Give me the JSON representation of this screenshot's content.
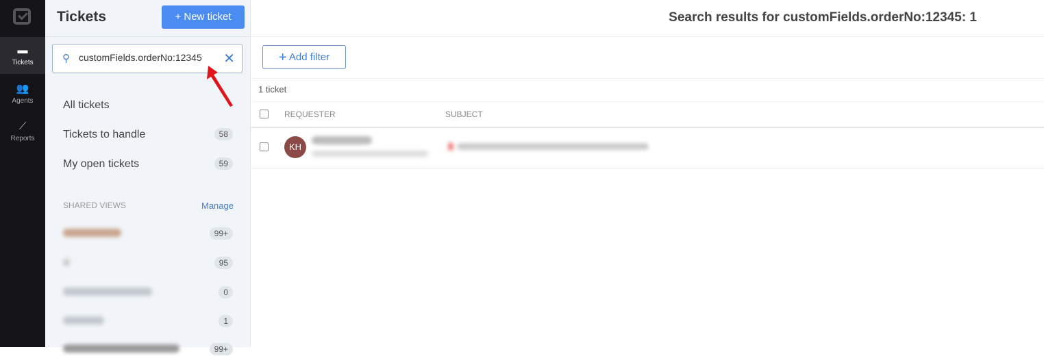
{
  "rail": {
    "items": [
      {
        "label": "Tickets",
        "icon": "ticket-icon"
      },
      {
        "label": "Agents",
        "icon": "agents-icon"
      },
      {
        "label": "Reports",
        "icon": "reports-icon"
      }
    ]
  },
  "sidebar": {
    "title": "Tickets",
    "new_ticket": "+ New ticket",
    "search_value": "customFields.orderNo:12345",
    "nav": [
      {
        "label": "All tickets"
      },
      {
        "label": "Tickets to handle",
        "count": "58"
      },
      {
        "label": "My open tickets",
        "count": "59"
      }
    ],
    "shared_views_label": "SHARED VIEWS",
    "manage": "Manage",
    "shared_views": [
      {
        "count": "99+"
      },
      {
        "count": "95"
      },
      {
        "count": "0"
      },
      {
        "count": "1"
      },
      {
        "count": "99+"
      }
    ]
  },
  "main": {
    "results_title": "Search results for customFields.orderNo:12345: 1",
    "add_filter": "Add filter",
    "ticket_count": "1 ticket",
    "columns": [
      "REQUESTER",
      "SUBJECT"
    ],
    "rows": [
      {
        "initials": "KH",
        "avatar_color": "#8b4a46"
      }
    ]
  },
  "colors": {
    "accent": "#4a8cf0",
    "rail": "#141418",
    "sidebar": "#f1f5f9"
  }
}
